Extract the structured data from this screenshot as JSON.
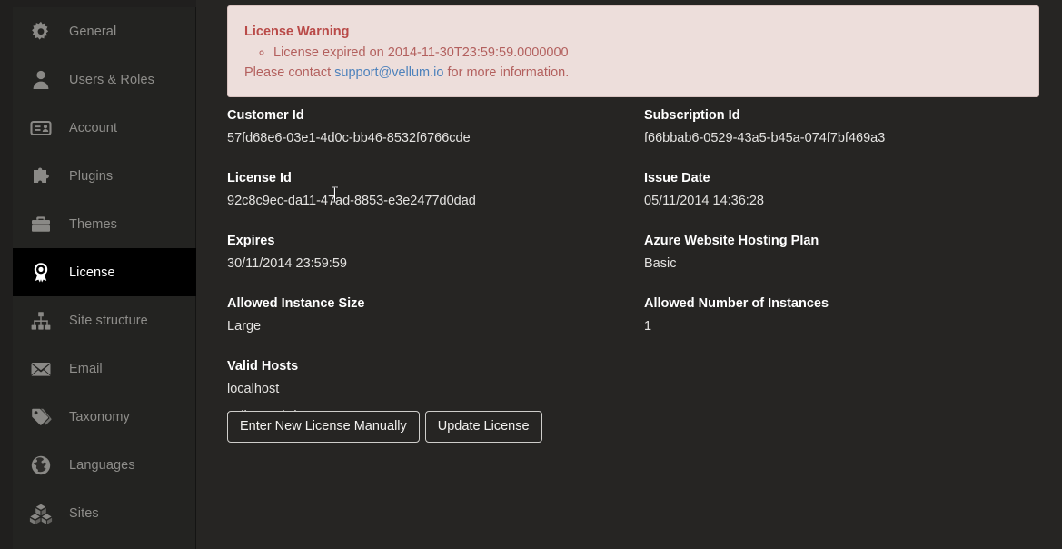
{
  "sidebar": {
    "items": [
      {
        "label": "General",
        "icon": "gear-icon",
        "active": false
      },
      {
        "label": "Users & Roles",
        "icon": "user-icon",
        "active": false
      },
      {
        "label": "Account",
        "icon": "id-card-icon",
        "active": false
      },
      {
        "label": "Plugins",
        "icon": "puzzle-piece-icon",
        "active": false
      },
      {
        "label": "Themes",
        "icon": "briefcase-icon",
        "active": false
      },
      {
        "label": "License",
        "icon": "award-badge-icon",
        "active": true
      },
      {
        "label": "Site structure",
        "icon": "sitemap-icon",
        "active": false
      },
      {
        "label": "Email",
        "icon": "envelope-icon",
        "active": false
      },
      {
        "label": "Taxonomy",
        "icon": "tags-icon",
        "active": false
      },
      {
        "label": "Languages",
        "icon": "globe-icon",
        "active": false
      },
      {
        "label": "Sites",
        "icon": "boxes-icon",
        "active": false
      }
    ]
  },
  "warning": {
    "title": "License Warning",
    "items": [
      "License expired on 2014-11-30T23:59:59.0000000"
    ],
    "contact_prefix": "Please contact ",
    "contact_email": "support@vellum.io",
    "contact_suffix": " for more information.",
    "background_color": "#eddedb",
    "text_color": "#b3605e",
    "title_color": "#b94a48",
    "link_color": "#4e82bc"
  },
  "details": {
    "left": [
      {
        "label": "Customer Id",
        "value": "57fd68e6-03e1-4d0c-bb46-8532f6766cde"
      },
      {
        "label": "License Id",
        "value": "92c8c9ec-da11-47ad-8853-e3e2477d0dad"
      },
      {
        "label": "Expires",
        "value": "30/11/2014 23:59:59"
      },
      {
        "label": "Allowed Instance Size",
        "value": "Large"
      }
    ],
    "right": [
      {
        "label": "Subscription Id",
        "value": "f66bbab6-0529-43a5-b45a-074f7bf469a3"
      },
      {
        "label": "Issue Date",
        "value": "05/11/2014 14:36:28"
      },
      {
        "label": "Azure Website Hosting Plan",
        "value": "Basic"
      },
      {
        "label": "Allowed Number of Instances",
        "value": "1"
      }
    ],
    "valid_hosts": {
      "label": "Valid Hosts",
      "link_host": "localhost",
      "plain_host": "vellumwebdev"
    }
  },
  "actions": {
    "enter_manually_label": "Enter New License Manually",
    "update_license_label": "Update License"
  }
}
